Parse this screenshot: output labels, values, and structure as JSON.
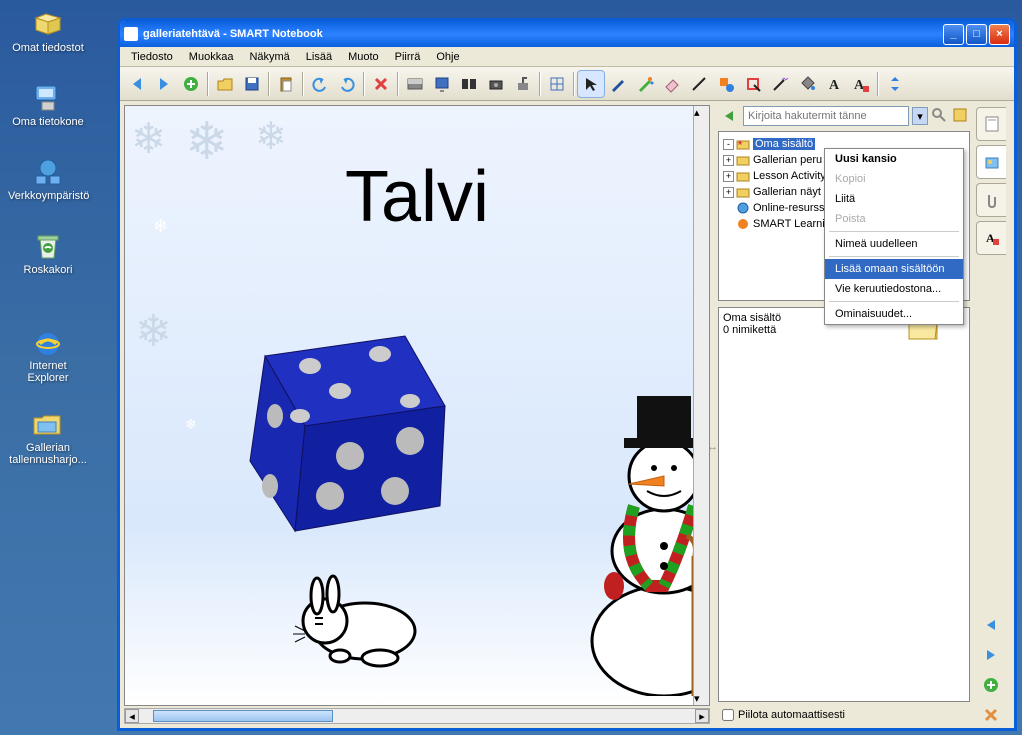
{
  "desktop": {
    "icons": [
      {
        "label": "Omat tiedostot"
      },
      {
        "label": "Oma tietokone"
      },
      {
        "label": "Verkkoympäristö"
      },
      {
        "label": "Roskakori"
      },
      {
        "label": "Internet Explorer"
      },
      {
        "label": "Gallerian tallennusharjo..."
      }
    ]
  },
  "window": {
    "title": "galleriatehtävä - SMART Notebook"
  },
  "menu": [
    "Tiedosto",
    "Muokkaa",
    "Näkymä",
    "Lisää",
    "Muoto",
    "Piirrä",
    "Ohje"
  ],
  "canvas": {
    "heading": "Talvi"
  },
  "search": {
    "placeholder": "Kirjoita hakutermit tänne"
  },
  "tree": [
    {
      "label": "Oma sisältö",
      "selected": true,
      "expand": "-",
      "icon": "star-folder"
    },
    {
      "label": "Gallerian peru",
      "expand": "+",
      "icon": "folder"
    },
    {
      "label": "Lesson Activity",
      "expand": "+",
      "icon": "folder"
    },
    {
      "label": "Gallerian näyt",
      "expand": "+",
      "icon": "folder"
    },
    {
      "label": "Online-resurss",
      "expand": " ",
      "icon": "globe"
    },
    {
      "label": "SMART Learnir",
      "expand": " ",
      "icon": "orange"
    }
  ],
  "content": {
    "line1": "Oma sisältö",
    "line2": "0 nimikettä"
  },
  "status": {
    "checkbox_label": "Piilota automaattisesti"
  },
  "context_menu": [
    {
      "label": "Uusi kansio",
      "type": "bold"
    },
    {
      "label": "Kopioi",
      "type": "disabled"
    },
    {
      "label": "Liitä",
      "type": "normal"
    },
    {
      "label": "Poista",
      "type": "disabled"
    },
    {
      "type": "sep"
    },
    {
      "label": "Nimeä uudelleen",
      "type": "normal"
    },
    {
      "type": "sep"
    },
    {
      "label": "Lisää omaan sisältöön",
      "type": "hl"
    },
    {
      "label": "Vie keruutiedostona...",
      "type": "normal"
    },
    {
      "type": "sep"
    },
    {
      "label": "Ominaisuudet...",
      "type": "normal"
    }
  ]
}
